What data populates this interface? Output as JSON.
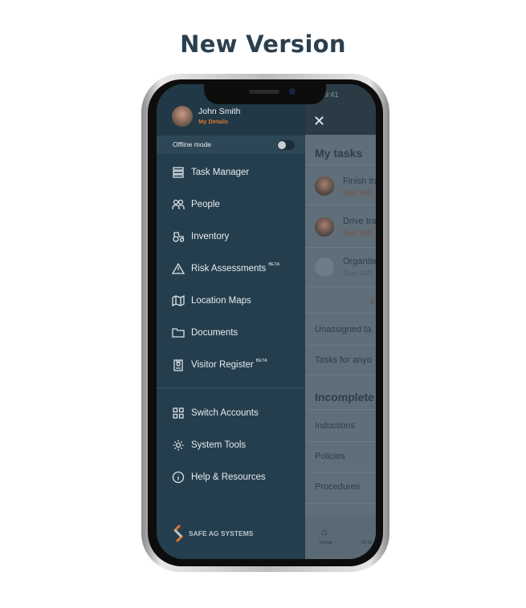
{
  "heading": "New Version",
  "status": {
    "time": "9:41"
  },
  "profile": {
    "name": "John Smith",
    "link": "My Details"
  },
  "offline": {
    "label": "Offline mode",
    "enabled": false
  },
  "menu": [
    {
      "label": "Task Manager",
      "icon": "task-manager-icon"
    },
    {
      "label": "People",
      "icon": "people-icon"
    },
    {
      "label": "Inventory",
      "icon": "tractor-icon"
    },
    {
      "label": "Risk Assessments",
      "icon": "warning-icon",
      "badge": "BETA"
    },
    {
      "label": "Location Maps",
      "icon": "map-icon"
    },
    {
      "label": "Documents",
      "icon": "folder-icon"
    },
    {
      "label": "Visitor Register",
      "icon": "badge-icon",
      "badge": "BETA"
    }
  ],
  "menu2": [
    {
      "label": "Switch Accounts",
      "icon": "grid-icon"
    },
    {
      "label": "System Tools",
      "icon": "gear-icon"
    },
    {
      "label": "Help & Resources",
      "icon": "info-icon"
    }
  ],
  "logo": "SAFE AG SYSTEMS",
  "behind": {
    "my_tasks": "My tasks",
    "tasks": [
      {
        "title": "Finish tra",
        "due": "Due: 00/0"
      },
      {
        "title": "Drive tra",
        "due": "Due: 00/0"
      },
      {
        "title": "Organise",
        "due": "Due: 00/0"
      }
    ],
    "see_all": "S",
    "unassigned": "Unassigned ta",
    "anyone": "Tasks for anyo",
    "incomplete": "Incomplete",
    "links": [
      "Inductions",
      "Policies",
      "Procedures"
    ],
    "nav": [
      "Home",
      "At W"
    ]
  },
  "colors": {
    "drawer": "#253e4d",
    "accent": "#d9782d"
  }
}
